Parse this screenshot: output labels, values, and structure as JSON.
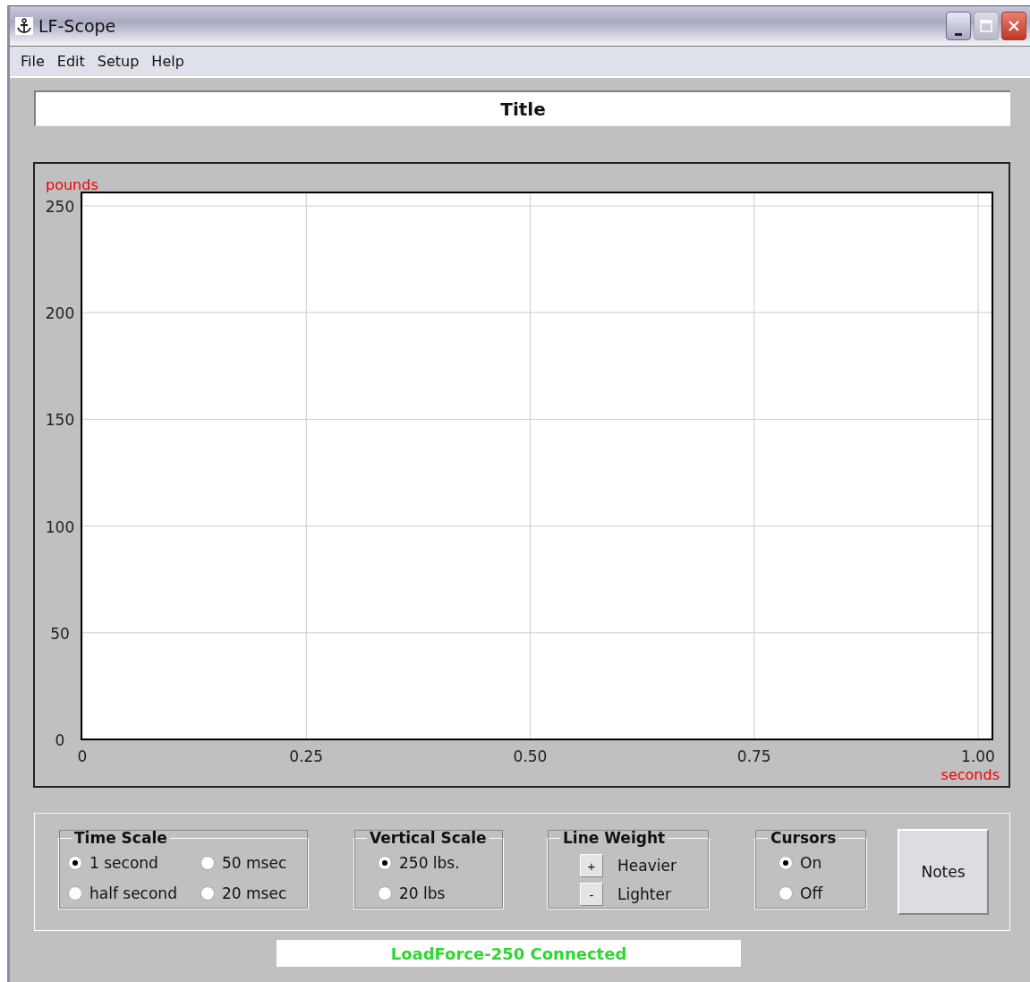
{
  "window": {
    "title": "LF-Scope"
  },
  "menu": [
    "File",
    "Edit",
    "Setup",
    "Help"
  ],
  "title_field": {
    "value": "Title"
  },
  "chart": {
    "chart_data": {
      "type": "line",
      "grid": true,
      "xlabel": "seconds",
      "ylabel": "pounds",
      "xlim": [
        0,
        1
      ],
      "ylim": [
        0,
        250
      ],
      "xticks": [
        {
          "value": 0,
          "label": "0"
        },
        {
          "value": 0.25,
          "label": "0.25"
        },
        {
          "value": 0.5,
          "label": "0.50"
        },
        {
          "value": 0.75,
          "label": "0.75"
        },
        {
          "value": 1,
          "label": "1.00"
        }
      ],
      "yticks": [
        0,
        50,
        100,
        150,
        200,
        250
      ]
    }
  },
  "time_scale": {
    "title": "Time Scale",
    "options": [
      {
        "label": "1 second",
        "selected": true
      },
      {
        "label": "50 msec",
        "selected": false
      },
      {
        "label": "half second",
        "selected": false
      },
      {
        "label": "20 msec",
        "selected": false
      }
    ]
  },
  "vertical_scale": {
    "title": "Vertical Scale",
    "options": [
      {
        "label": "250 lbs.",
        "selected": true
      },
      {
        "label": "20 lbs",
        "selected": false
      }
    ]
  },
  "line_weight": {
    "title": "Line Weight",
    "buttons": [
      {
        "symbol": "+",
        "label": "Heavier"
      },
      {
        "symbol": "-",
        "label": "Lighter"
      }
    ]
  },
  "cursors": {
    "title": "Cursors",
    "options": [
      {
        "label": "On",
        "selected": true
      },
      {
        "label": "Off",
        "selected": false
      }
    ]
  },
  "notes_button": "Notes",
  "status": "LoadForce-250 Connected"
}
